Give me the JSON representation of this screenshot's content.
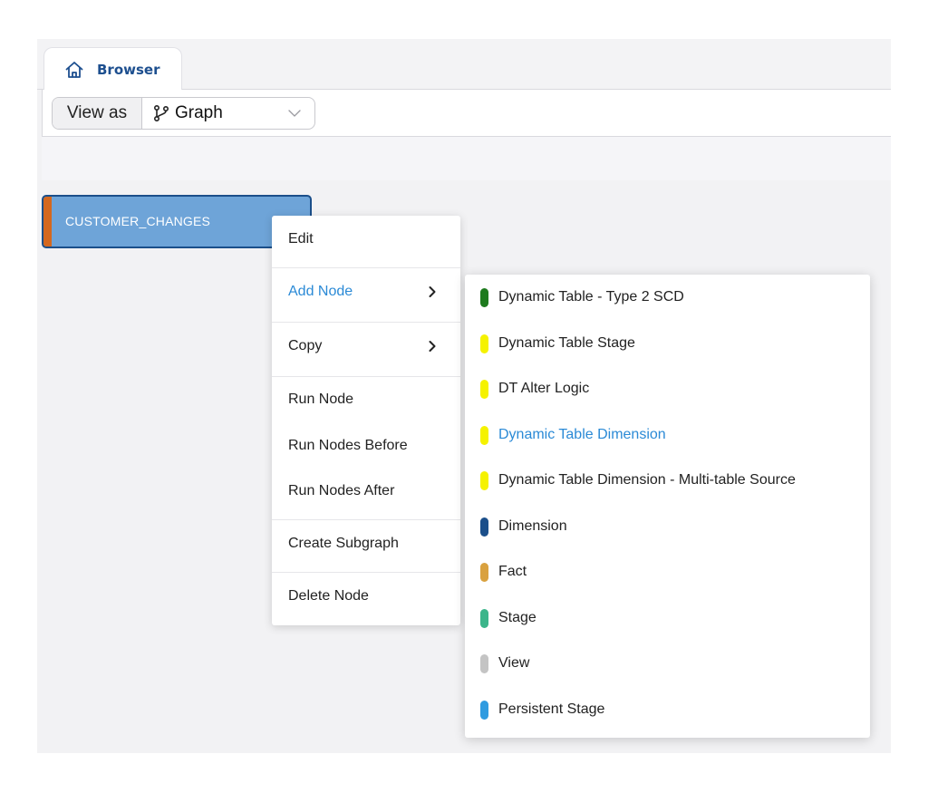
{
  "tabs": [
    {
      "label": "Browser",
      "icon": "home-icon"
    }
  ],
  "toolbar": {
    "view_as_label": "View as",
    "view_mode": "Graph",
    "view_mode_icon": "git-branch-icon"
  },
  "node": {
    "name": "CUSTOMER_CHANGES",
    "accent_color": "#d4681f",
    "fill_color": "#6ea4d8"
  },
  "context_menu": {
    "items": [
      {
        "label": "Edit"
      },
      {
        "label": "Add Node",
        "has_submenu": true,
        "active": true
      },
      {
        "label": "Copy",
        "has_submenu": true
      },
      {
        "label": "Run Node"
      },
      {
        "label": "Run Nodes Before"
      },
      {
        "label": "Run Nodes After"
      },
      {
        "label": "Create Subgraph"
      },
      {
        "label": "Delete Node"
      }
    ]
  },
  "add_node_submenu": {
    "items": [
      {
        "label": "Dynamic Table - Type 2 SCD",
        "color": "#1d7a1d"
      },
      {
        "label": "Dynamic Table Stage",
        "color": "#f5f200"
      },
      {
        "label": "DT Alter Logic",
        "color": "#f5f200"
      },
      {
        "label": "Dynamic Table Dimension",
        "color": "#f5f200",
        "active": true
      },
      {
        "label": "Dynamic Table Dimension - Multi-table Source",
        "color": "#f5f200"
      },
      {
        "label": "Dimension",
        "color": "#1b4f8a"
      },
      {
        "label": "Fact",
        "color": "#d9a13f"
      },
      {
        "label": "Stage",
        "color": "#3bb58a"
      },
      {
        "label": "View",
        "color": "#c4c4c4"
      },
      {
        "label": "Persistent Stage",
        "color": "#2f9be0"
      }
    ]
  },
  "colors": {
    "accent_link": "#2b8ad6",
    "tab_text": "#1d4f8f"
  }
}
